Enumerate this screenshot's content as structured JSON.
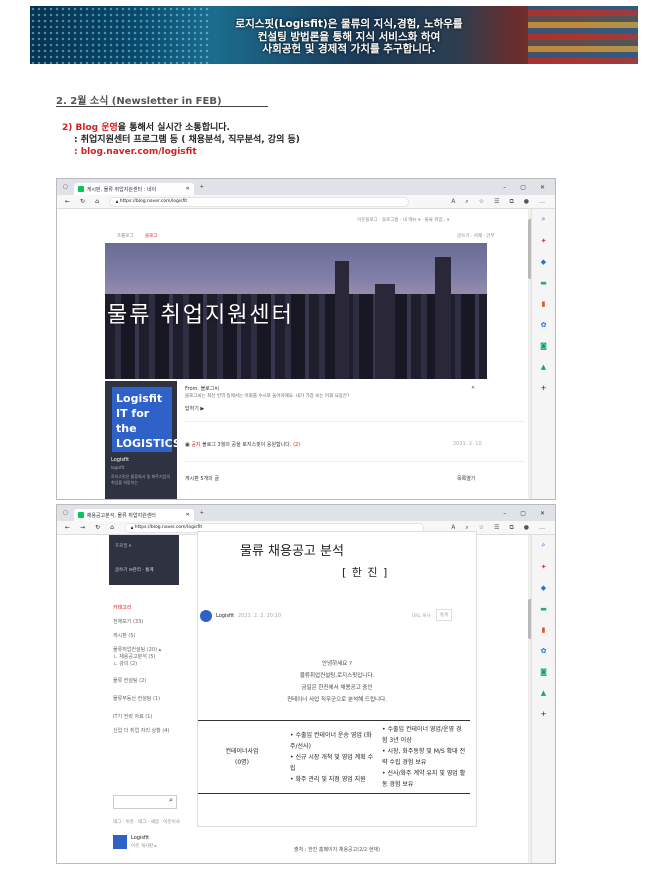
{
  "banner": {
    "line1": "로지스핏(Logisfit)은 물류의 지식,경험, 노하우를",
    "line2": "컨설팅 방법론을 통해 지식 서비스화 하여",
    "line3": "사회공헌 및 경제적 가치를 추구합니다."
  },
  "section": {
    "title": "2. 2월 소식 (Newsletter in FEB)",
    "item_prefix": "2) ",
    "item_red": "Blog 운영",
    "item_rest": "을 통해서 실시간 소통합니다.",
    "line2": ": 취업지원센터 프로그램 등 ( 채용분석, 직무분석, 강의 등)",
    "line3": ": blog.naver.com/logisfit"
  },
  "browser1": {
    "tab_title": "게시판, 물류 취업지원센터 : 네이",
    "url": "https://blog.naver.com/logisfit",
    "top_links": "이웃블로그 · 블로그홈 · 내 메뉴 ▾ · 물류 취업..  ▾",
    "prologue": "프롤로그",
    "blog_tab": "블로그",
    "write_link": "글쓰기 · 서재 · 안부",
    "hero_title": "물류 취업지원센터",
    "logo_line1": "Logisfit",
    "logo_line2": "IT for the",
    "logo_line3": "LOGISTICS",
    "profile_name": "Logisfit",
    "profile_id": "logisfit",
    "profile_desc": "로지스핏은 물류회사 및 화주기업의 취업을 희망하는",
    "post_from": "From. 블로그씨",
    "post_body": "블로그씨는 최신 번역 등에서는 어휘를 수시로 들어야해요. 내가 가장 보는 어휘 요동은?",
    "post_more": "답하기 ▶",
    "notice_label": "공지",
    "notice_text": "블로그 3월의 공을 로지스핏이 응원합니다.",
    "notice_count": "(2)",
    "notice_date": "2021. 2. 10",
    "posts_label": "게시판 5개의 글",
    "list_toggle": "목록열기"
  },
  "browser2": {
    "tab_title": "채용공고분석, 물류 취업지원센터",
    "url": "https://blog.naver.com/logisfit",
    "side_link1": "프로필 ▾",
    "side_link2": "글쓰기 ✉관리 · 통계",
    "category_title": "카테고리",
    "categories": [
      "전체보기 (33)",
      "게시판 (5)",
      "물류취업컨설팅 (20) ▴",
      "ㄴ 채용공고분석 (5)",
      "ㄴ 강의 (2)",
      "물류 컨설팅 (2)",
      "물류부동산 컨설팅 (1)",
      "IT기 전략 자료 (1)",
      "신입 더 취업 자리 상황 (4)"
    ],
    "widget_links": "태그 · 이웃 · 태그 · 새글 · 이웃이사",
    "profile_name": "Logisfit",
    "profile_sub": "이웃 게시판 ▸",
    "article_title": "물류 채용공고 분석",
    "article_subtitle": "[ 한 진 ]",
    "author": "Logisfit",
    "post_date": "2021. 2. 2. 20:10",
    "url_copy": "URL 복사",
    "stats_label": "통계",
    "intro": [
      "안녕하세요 ?",
      "물류취업컨설팅,로지스핏입니다.",
      "금일은 한진에서 채용공고 중인",
      "컨테이너 사업 직무군으로 분석해 드립니다."
    ],
    "job_title": "컨테이너사업",
    "job_count": "(0명)",
    "duties": [
      "• 수출입 컨테이너 운송 영업 (화주/선사)",
      "• 신규 시장 개척 및 영업 계획 수립",
      "• 화주 관리 및 지점 영업 지원"
    ],
    "requirements": [
      "• 수출입 컨테이너 영업/운영 경험 3년 이상",
      "• 시장, 화주동향 및 M/S 확대 전략 수립 경험 보유",
      "• 선사/화주 계약 유지 및 영업 활동 경험 보유"
    ],
    "source": "출처 : 한진 홈페이지 채용공고(2/2 현재)"
  }
}
